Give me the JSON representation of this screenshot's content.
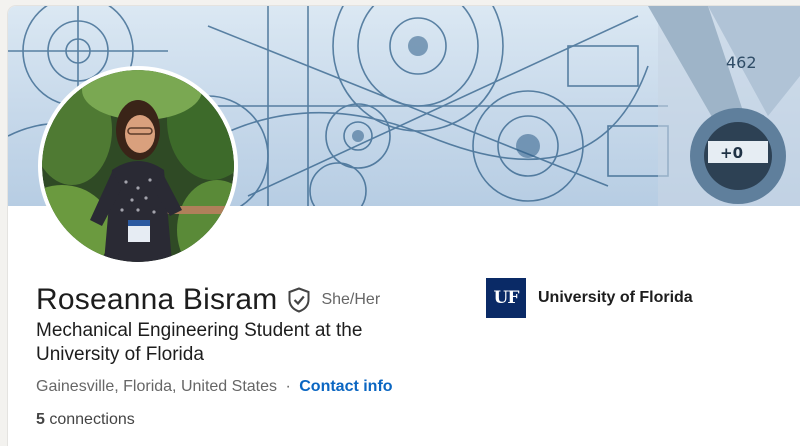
{
  "profile": {
    "name": "Roseanna Bisram",
    "pronouns": "She/Her",
    "headline": "Mechanical Engineering Student at the University of Florida",
    "location": "Gainesville, Florida, United States",
    "separator": "·",
    "contact_info_label": "Contact info",
    "connections_count": "5",
    "connections_label": "connections"
  },
  "education": {
    "logo_text": "UF",
    "name": "University of Florida"
  },
  "banner": {
    "measure_label": "462",
    "scale_label": "+0"
  },
  "icons": {
    "verification": "shield-check-icon"
  },
  "colors": {
    "link": "#0a66c2",
    "uf_blue": "#0a2a66",
    "banner_line": "#2f5f88"
  }
}
